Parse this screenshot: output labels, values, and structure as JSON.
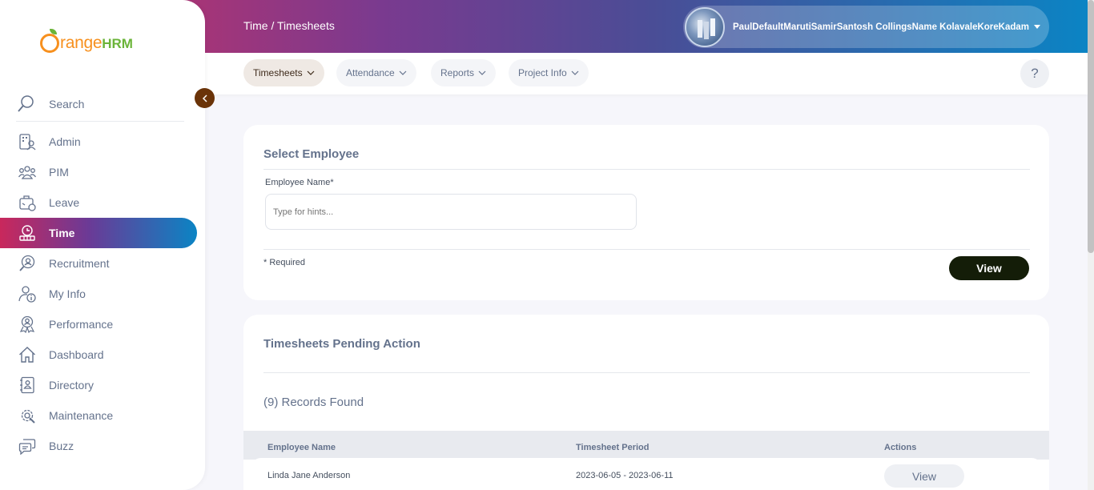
{
  "brand": {
    "logo_text": "range",
    "logo_accent": "HRM"
  },
  "header": {
    "breadcrumb": "Time / Timesheets",
    "user_name": "PaulDefaultMarutiSamirSantosh CollingsName KolavaleKoreKadam",
    "help": "?"
  },
  "tabs": [
    {
      "label": "Timesheets",
      "active": true
    },
    {
      "label": "Attendance",
      "active": false
    },
    {
      "label": "Reports",
      "active": false
    },
    {
      "label": "Project Info",
      "active": false
    }
  ],
  "sidebar": {
    "search_label": "Search",
    "items": [
      {
        "label": "Admin",
        "icon": "admin-icon"
      },
      {
        "label": "PIM",
        "icon": "pim-icon"
      },
      {
        "label": "Leave",
        "icon": "leave-icon"
      },
      {
        "label": "Time",
        "icon": "time-icon",
        "active": true
      },
      {
        "label": "Recruitment",
        "icon": "recruitment-icon"
      },
      {
        "label": "My Info",
        "icon": "my-info-icon"
      },
      {
        "label": "Performance",
        "icon": "performance-icon"
      },
      {
        "label": "Dashboard",
        "icon": "dashboard-icon"
      },
      {
        "label": "Directory",
        "icon": "directory-icon"
      },
      {
        "label": "Maintenance",
        "icon": "maintenance-icon"
      },
      {
        "label": "Buzz",
        "icon": "buzz-icon"
      }
    ]
  },
  "select_employee": {
    "title": "Select Employee",
    "field_label": "Employee Name*",
    "placeholder": "Type for hints...",
    "required_note": "* Required",
    "view_button": "View"
  },
  "pending": {
    "title": "Timesheets Pending Action",
    "records_found": "(9) Records Found",
    "columns": [
      "Employee Name",
      "Timesheet Period",
      "Actions"
    ],
    "rows": [
      {
        "employee": "Linda Jane Anderson",
        "period": "2023-06-05 - 2023-06-11",
        "action": "View"
      }
    ]
  },
  "colors": {
    "brand_orange": "#f7901e",
    "brand_green": "#6bb439",
    "primary_button": "#141d08",
    "collapse_button": "#6a3308"
  }
}
